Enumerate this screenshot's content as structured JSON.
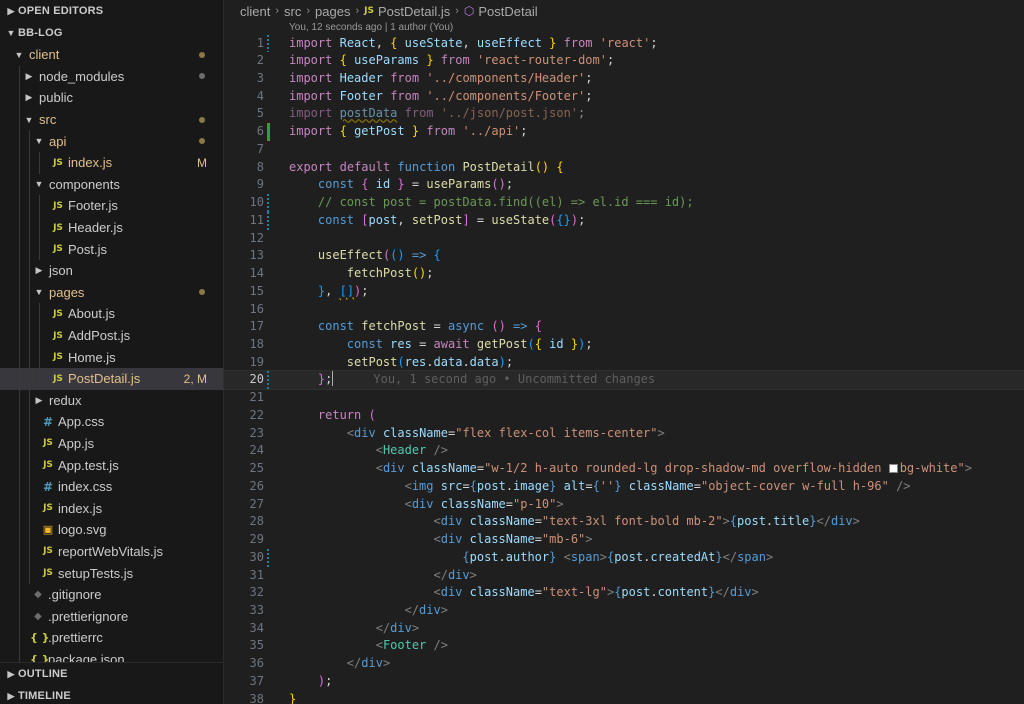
{
  "sidebar": {
    "open_editors_label": "OPEN EDITORS",
    "project_label": "BB-LOG",
    "outline_label": "OUTLINE",
    "timeline_label": "TIMELINE",
    "tree": [
      {
        "label": "client",
        "icon": "chevron-down-icon",
        "depth": 0,
        "mod": true,
        "status": "dot"
      },
      {
        "label": "node_modules",
        "icon": "chevron-right-icon",
        "depth": 1,
        "mod": false,
        "status": "dot-grey"
      },
      {
        "label": "public",
        "icon": "chevron-right-icon",
        "depth": 1,
        "mod": false,
        "status": ""
      },
      {
        "label": "src",
        "icon": "chevron-down-icon",
        "depth": 1,
        "mod": true,
        "status": "dot"
      },
      {
        "label": "api",
        "icon": "chevron-down-icon",
        "depth": 2,
        "mod": true,
        "status": "dot"
      },
      {
        "label": "index.js",
        "icon": "js-file-icon",
        "depth": 3,
        "mod": true,
        "status": "M"
      },
      {
        "label": "components",
        "icon": "chevron-down-icon",
        "depth": 2,
        "mod": false,
        "status": ""
      },
      {
        "label": "Footer.js",
        "icon": "js-file-icon",
        "depth": 3,
        "mod": false,
        "status": ""
      },
      {
        "label": "Header.js",
        "icon": "js-file-icon",
        "depth": 3,
        "mod": false,
        "status": ""
      },
      {
        "label": "Post.js",
        "icon": "js-file-icon",
        "depth": 3,
        "mod": false,
        "status": ""
      },
      {
        "label": "json",
        "icon": "chevron-right-icon",
        "depth": 2,
        "mod": false,
        "status": ""
      },
      {
        "label": "pages",
        "icon": "chevron-down-icon",
        "depth": 2,
        "mod": true,
        "status": "dot"
      },
      {
        "label": "About.js",
        "icon": "js-file-icon",
        "depth": 3,
        "mod": false,
        "status": ""
      },
      {
        "label": "AddPost.js",
        "icon": "js-file-icon",
        "depth": 3,
        "mod": false,
        "status": ""
      },
      {
        "label": "Home.js",
        "icon": "js-file-icon",
        "depth": 3,
        "mod": false,
        "status": ""
      },
      {
        "label": "PostDetail.js",
        "icon": "js-file-icon",
        "depth": 3,
        "mod": true,
        "status": "2, M",
        "selected": true
      },
      {
        "label": "redux",
        "icon": "chevron-right-icon",
        "depth": 2,
        "mod": false,
        "status": ""
      },
      {
        "label": "App.css",
        "icon": "css-file-icon",
        "depth": 2,
        "mod": false,
        "status": ""
      },
      {
        "label": "App.js",
        "icon": "js-file-icon",
        "depth": 2,
        "mod": false,
        "status": ""
      },
      {
        "label": "App.test.js",
        "icon": "js-file-icon",
        "depth": 2,
        "mod": false,
        "status": ""
      },
      {
        "label": "index.css",
        "icon": "css-file-icon",
        "depth": 2,
        "mod": false,
        "status": ""
      },
      {
        "label": "index.js",
        "icon": "js-file-icon",
        "depth": 2,
        "mod": false,
        "status": ""
      },
      {
        "label": "logo.svg",
        "icon": "svg-file-icon",
        "depth": 2,
        "mod": false,
        "status": ""
      },
      {
        "label": "reportWebVitals.js",
        "icon": "js-file-icon",
        "depth": 2,
        "mod": false,
        "status": ""
      },
      {
        "label": "setupTests.js",
        "icon": "js-file-icon",
        "depth": 2,
        "mod": false,
        "status": ""
      },
      {
        "label": ".gitignore",
        "icon": "git-file-icon",
        "depth": 1,
        "mod": false,
        "status": ""
      },
      {
        "label": ".prettierignore",
        "icon": "git-file-icon",
        "depth": 1,
        "mod": false,
        "status": ""
      },
      {
        "label": ".prettierrc",
        "icon": "json-file-icon",
        "depth": 1,
        "mod": false,
        "status": ""
      },
      {
        "label": "package.json",
        "icon": "json-file-icon",
        "depth": 1,
        "mod": false,
        "status": ""
      }
    ]
  },
  "editor": {
    "breadcrumb": [
      "client",
      "src",
      "pages",
      "PostDetail.js",
      "PostDetail"
    ],
    "codelens": "You, 12 seconds ago | 1 author (You)",
    "inline_blame": "You, 1 second ago • Uncommitted changes",
    "current_line": 20,
    "lines": [
      {
        "n": 1,
        "g": "mod",
        "html": "<span class=\"c\">import</span> <span class=\"v\">React</span>, <span class=\"b1\">{</span> <span class=\"v\">useState</span>, <span class=\"v\">useEffect</span> <span class=\"b1\">}</span> <span class=\"c\">from</span> <span class=\"s\">'react'</span>;"
      },
      {
        "n": 2,
        "g": "",
        "html": "<span class=\"c\">import</span> <span class=\"b1\">{</span> <span class=\"v\">useParams</span> <span class=\"b1\">}</span> <span class=\"c\">from</span> <span class=\"s\">'react-router-dom'</span>;"
      },
      {
        "n": 3,
        "g": "",
        "html": "<span class=\"c\">import</span> <span class=\"v\">Header</span> <span class=\"c\">from</span> <span class=\"s\">'../components/Header'</span>;"
      },
      {
        "n": 4,
        "g": "",
        "html": "<span class=\"c\">import</span> <span class=\"v\">Footer</span> <span class=\"c\">from</span> <span class=\"s\">'../components/Footer'</span>;"
      },
      {
        "n": 5,
        "g": "",
        "html": "<span class=\"dim\"><span class=\"c\">import</span> <span class=\"v squig\">postData</span> <span class=\"c\">from</span> <span class=\"s\">'../json/post.json'</span>;</span>"
      },
      {
        "n": 6,
        "g": "add",
        "html": "<span class=\"c\">import</span> <span class=\"b1\">{</span> <span class=\"v\">getPost</span> <span class=\"b1\">}</span> <span class=\"c\">from</span> <span class=\"s\">'../api'</span>;"
      },
      {
        "n": 7,
        "g": "",
        "html": ""
      },
      {
        "n": 8,
        "g": "",
        "html": "<span class=\"c\">export</span> <span class=\"c\">default</span> <span class=\"k\">function</span> <span class=\"f\">PostDetail</span><span class=\"b1\">()</span> <span class=\"b1\">{</span>"
      },
      {
        "n": 9,
        "g": "",
        "html": "    <span class=\"k\">const</span> <span class=\"b2\">{</span> <span class=\"v\">id</span> <span class=\"b2\">}</span> = <span class=\"f\">useParams</span><span class=\"b2\">()</span>;"
      },
      {
        "n": 10,
        "g": "mod",
        "html": "    <span class=\"cm\">// const post = postData.find((el) =&gt; el.id === id);</span>"
      },
      {
        "n": 11,
        "g": "mod",
        "html": "    <span class=\"k\">const</span> <span class=\"b2\">[</span><span class=\"v\">post</span>, <span class=\"f\">setPost</span><span class=\"b2\">]</span> = <span class=\"f\">useState</span><span class=\"b2\">(</span><span class=\"b3\">{}</span><span class=\"b2\">)</span>;"
      },
      {
        "n": 12,
        "g": "",
        "html": ""
      },
      {
        "n": 13,
        "g": "",
        "html": "    <span class=\"f\">useEffect</span><span class=\"b2\">(</span><span class=\"b3\">()</span> <span class=\"k\">=&gt;</span> <span class=\"b3\">{</span>"
      },
      {
        "n": 14,
        "g": "",
        "html": "        <span class=\"f\">fetchPost</span><span class=\"b1\">()</span>;"
      },
      {
        "n": 15,
        "g": "",
        "html": "    <span class=\"b3\">}</span>, <span class=\"b3 squig\">[]</span><span class=\"b2\">)</span>;"
      },
      {
        "n": 16,
        "g": "",
        "html": ""
      },
      {
        "n": 17,
        "g": "",
        "html": "    <span class=\"k\">const</span> <span class=\"f\">fetchPost</span> = <span class=\"k\">async</span> <span class=\"b2\">()</span> <span class=\"k\">=&gt;</span> <span class=\"b2\">{</span>"
      },
      {
        "n": 18,
        "g": "",
        "html": "        <span class=\"k\">const</span> <span class=\"v\">res</span> = <span class=\"c\">await</span> <span class=\"f\">getPost</span><span class=\"b3\">(</span><span class=\"b1\">{</span> <span class=\"v\">id</span> <span class=\"b1\">}</span><span class=\"b3\">)</span>;"
      },
      {
        "n": 19,
        "g": "",
        "html": "        <span class=\"f\">setPost</span><span class=\"b3\">(</span><span class=\"v\">res</span>.<span class=\"v\">data</span>.<span class=\"v\">data</span><span class=\"b3\">)</span>;"
      },
      {
        "n": 20,
        "g": "mod",
        "html": "    <span class=\"b2\">}</span>;<span class=\"cursor\"></span>"
      },
      {
        "n": 21,
        "g": "",
        "html": ""
      },
      {
        "n": 22,
        "g": "",
        "html": "    <span class=\"c\">return</span> <span class=\"b2\">(</span>"
      },
      {
        "n": 23,
        "g": "",
        "html": "        <span class=\"pu\">&lt;</span><span class=\"tg\">div</span> <span class=\"at\">className</span>=<span class=\"s\">\"flex flex-col items-center\"</span><span class=\"pu\">&gt;</span>"
      },
      {
        "n": 24,
        "g": "",
        "html": "            <span class=\"pu\">&lt;</span><span class=\"t\">Header</span> <span class=\"pu\">/&gt;</span>"
      },
      {
        "n": 25,
        "g": "",
        "html": "            <span class=\"pu\">&lt;</span><span class=\"tg\">div</span> <span class=\"at\">className</span>=<span class=\"s\">\"w-1/2 h-auto rounded-lg drop-shadow-md overflow-hidden <span class=\"swatch\"></span>bg-white\"</span><span class=\"pu\">&gt;</span>"
      },
      {
        "n": 26,
        "g": "",
        "html": "                <span class=\"pu\">&lt;</span><span class=\"tg\">img</span> <span class=\"at\">src</span>=<span class=\"k\">{</span><span class=\"v\">post</span>.<span class=\"v\">image</span><span class=\"k\">}</span> <span class=\"at\">alt</span>=<span class=\"k\">{</span><span class=\"s\">''</span><span class=\"k\">}</span> <span class=\"at\">className</span>=<span class=\"s\">\"object-cover w-full h-96\"</span> <span class=\"pu\">/&gt;</span>"
      },
      {
        "n": 27,
        "g": "",
        "html": "                <span class=\"pu\">&lt;</span><span class=\"tg\">div</span> <span class=\"at\">className</span>=<span class=\"s\">\"p-10\"</span><span class=\"pu\">&gt;</span>"
      },
      {
        "n": 28,
        "g": "",
        "html": "                    <span class=\"pu\">&lt;</span><span class=\"tg\">div</span> <span class=\"at\">className</span>=<span class=\"s\">\"text-3xl font-bold mb-2\"</span><span class=\"pu\">&gt;</span><span class=\"k\">{</span><span class=\"v\">post</span>.<span class=\"v\">title</span><span class=\"k\">}</span><span class=\"pu\">&lt;/</span><span class=\"tg\">div</span><span class=\"pu\">&gt;</span>"
      },
      {
        "n": 29,
        "g": "",
        "html": "                    <span class=\"pu\">&lt;</span><span class=\"tg\">div</span> <span class=\"at\">className</span>=<span class=\"s\">\"mb-6\"</span><span class=\"pu\">&gt;</span>"
      },
      {
        "n": 30,
        "g": "mod",
        "html": "                        <span class=\"k\">{</span><span class=\"v\">post</span>.<span class=\"v\">author</span><span class=\"k\">}</span> <span class=\"pu\">&lt;</span><span class=\"tg\">span</span><span class=\"pu\">&gt;</span><span class=\"k\">{</span><span class=\"v\">post</span>.<span class=\"v\">createdAt</span><span class=\"k\">}</span><span class=\"pu\">&lt;/</span><span class=\"tg\">span</span><span class=\"pu\">&gt;</span>"
      },
      {
        "n": 31,
        "g": "",
        "html": "                    <span class=\"pu\">&lt;/</span><span class=\"tg\">div</span><span class=\"pu\">&gt;</span>"
      },
      {
        "n": 32,
        "g": "",
        "html": "                    <span class=\"pu\">&lt;</span><span class=\"tg\">div</span> <span class=\"at\">className</span>=<span class=\"s\">\"text-lg\"</span><span class=\"pu\">&gt;</span><span class=\"k\">{</span><span class=\"v\">post</span>.<span class=\"v\">content</span><span class=\"k\">}</span><span class=\"pu\">&lt;/</span><span class=\"tg\">div</span><span class=\"pu\">&gt;</span>"
      },
      {
        "n": 33,
        "g": "",
        "html": "                <span class=\"pu\">&lt;/</span><span class=\"tg\">div</span><span class=\"pu\">&gt;</span>"
      },
      {
        "n": 34,
        "g": "",
        "html": "            <span class=\"pu\">&lt;/</span><span class=\"tg\">div</span><span class=\"pu\">&gt;</span>"
      },
      {
        "n": 35,
        "g": "",
        "html": "            <span class=\"pu\">&lt;</span><span class=\"t\">Footer</span> <span class=\"pu\">/&gt;</span>"
      },
      {
        "n": 36,
        "g": "",
        "html": "        <span class=\"pu\">&lt;/</span><span class=\"tg\">div</span><span class=\"pu\">&gt;</span>"
      },
      {
        "n": 37,
        "g": "",
        "html": "    <span class=\"b2\">)</span>;"
      },
      {
        "n": 38,
        "g": "",
        "html": "<span class=\"b1\">}</span>"
      }
    ]
  }
}
